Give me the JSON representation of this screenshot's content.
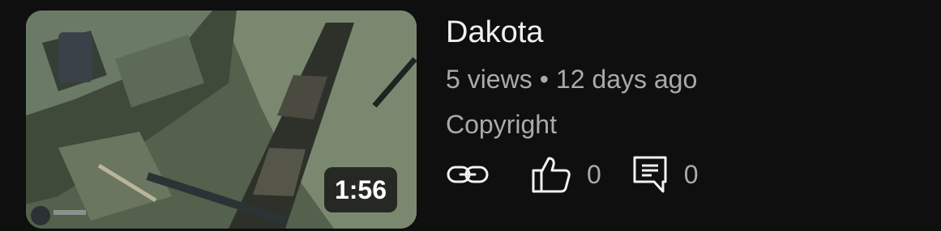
{
  "video": {
    "title": "Dakota",
    "views": "5 views",
    "separator": "•",
    "age": "12 days ago",
    "rights": "Copyright",
    "duration": "1:56",
    "like_count": "0",
    "comment_count": "0"
  },
  "icons": {
    "link": "link-icon",
    "like": "thumbs-up-icon",
    "comment": "comment-icon"
  },
  "colors": {
    "background": "#0f0f0f",
    "primary_text": "#f1f1f1",
    "secondary_text": "#aaaaaa"
  }
}
